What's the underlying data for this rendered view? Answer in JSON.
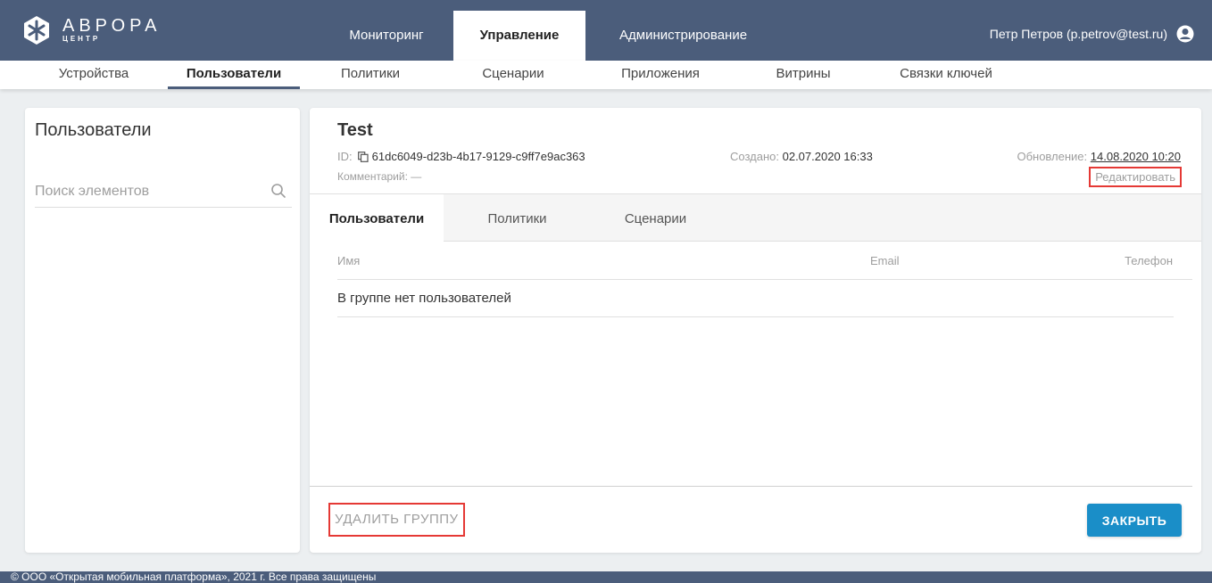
{
  "brand": {
    "title": "АВРОРА",
    "subtitle": "ЦЕНТР"
  },
  "top_nav": {
    "tabs": [
      {
        "label": "Мониторинг",
        "active": false
      },
      {
        "label": "Управление",
        "active": true
      },
      {
        "label": "Администрирование",
        "active": false
      }
    ]
  },
  "user": {
    "label": "Петр Петров (p.petrov@test.ru)",
    "icon": "user-circle-icon"
  },
  "sub_nav": {
    "items": [
      {
        "label": "Устройства",
        "active": false
      },
      {
        "label": "Пользователи",
        "active": true
      },
      {
        "label": "Политики",
        "active": false
      },
      {
        "label": "Сценарии",
        "active": false
      },
      {
        "label": "Приложения",
        "active": false
      },
      {
        "label": "Витрины",
        "active": false
      },
      {
        "label": "Связки ключей",
        "active": false
      }
    ]
  },
  "sidebar": {
    "title": "Пользователи",
    "search_placeholder": "Поиск элементов"
  },
  "group": {
    "name": "Test",
    "id_label": "ID:",
    "id_value": "61dc6049-d23b-4b17-9129-c9ff7e9ac363",
    "created_label": "Создано:",
    "created_value": "02.07.2020 16:33",
    "updated_label": "Обновление:",
    "updated_value": "14.08.2020 10:20",
    "comment_label": "Комментарий:",
    "comment_value": "—",
    "edit_label": "Редактировать"
  },
  "tabs": [
    {
      "label": "Пользователи",
      "active": true
    },
    {
      "label": "Политики",
      "active": false
    },
    {
      "label": "Сценарии",
      "active": false
    }
  ],
  "table": {
    "columns": [
      "Имя",
      "Email",
      "Телефон"
    ],
    "empty_text": "В группе нет пользователей"
  },
  "actions": {
    "delete_label": "УДАЛИТЬ ГРУППУ",
    "close_label": "ЗАКРЫТЬ"
  },
  "footer": {
    "text": "© ООО «Открытая мобильная платформа», 2021 г. Все права защищены"
  },
  "colors": {
    "header_bg": "#4b5d7b",
    "accent_blue": "#1a8ec8",
    "highlight_red": "#e53935"
  }
}
